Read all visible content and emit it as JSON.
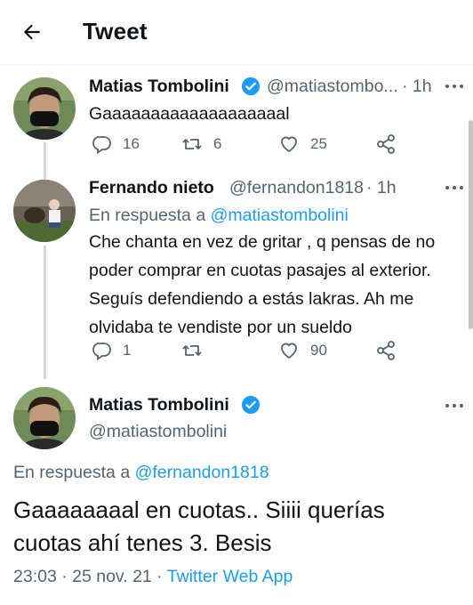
{
  "header": {
    "title": "Tweet"
  },
  "tweets": [
    {
      "name": "Matias Tombolini",
      "handle": "@matiastombo...",
      "time": "· 1h",
      "text": "Gaaaaaaaaaaaaaaaaaaal",
      "replies": "16",
      "retweets": "6",
      "likes": "25"
    },
    {
      "name": "Fernando nieto",
      "handle": "@fernandon1818",
      "time": "· 1h",
      "reply_prefix": "En respuesta a",
      "reply_to": "@matiastombolini",
      "lines": [
        "Che chanta en vez de gritar , q pensas de no",
        "poder comprar en cuotas pasajes al exterior.",
        "Seguís defendiendo a estás lakras. Ah me",
        "olvidaba te vendiste por un sueldo"
      ],
      "replies": "1",
      "retweets": "",
      "likes": "90"
    }
  ],
  "main": {
    "name": "Matias Tombolini",
    "handle": "@matiastombolini",
    "reply_prefix": "En respuesta a",
    "reply_to": "@fernandon1818",
    "lines": [
      "Gaaaaaaaal en cuotas.. Siiii querías",
      "cuotas ahí tenes 3. Besis"
    ],
    "time": "23:03 · 25 nov. 21 ·",
    "app": "Twitter Web App"
  },
  "colors": {
    "accent": "#1d9bf0",
    "muted": "#536471",
    "text": "#0f1419"
  }
}
